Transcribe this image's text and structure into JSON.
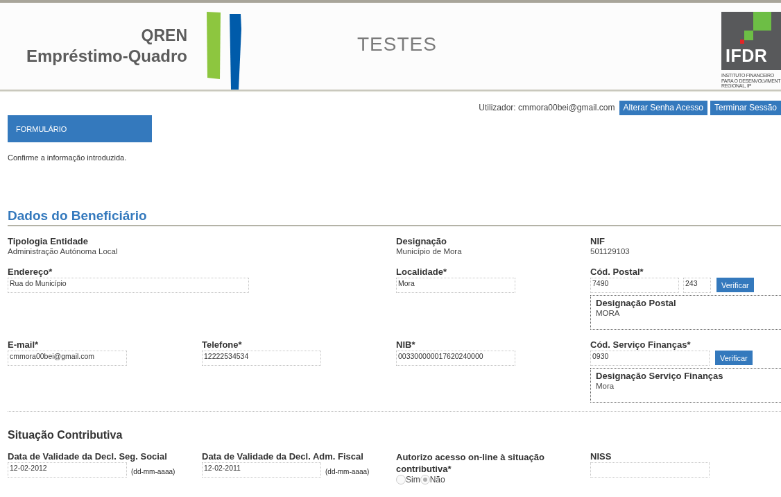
{
  "header": {
    "app_label": "QREN",
    "app_name": "Empréstimo-Quadro",
    "environment": "TESTES",
    "org_logo": {
      "acronym": "IFDR",
      "lines": [
        "INSTITUTO FINANCEIRO",
        "PARA O DESENVOLVIMENT",
        "REGIONAL, IP"
      ]
    }
  },
  "user_bar": {
    "user_label": "Utilizador: cmmora00bei@gmail.com",
    "buttons": [
      "Alterar Senha Acesso",
      "Terminar Sessão"
    ]
  },
  "tabs": [
    {
      "label": "FORMULÁRIO",
      "selected": true
    }
  ],
  "notice": "Confirme a informação introduzida.",
  "beneficiary": {
    "title": "Dados do Beneficiário",
    "rows": [
      [
        {
          "kind": "readonly",
          "label": "Tipologia Entidade",
          "value": "Administração Autónoma Local"
        },
        {
          "kind": "empty"
        },
        {
          "kind": "readonly",
          "label": "Designação",
          "value": "Município de Mora"
        },
        {
          "kind": "readonly",
          "label": "NIF",
          "value": "501129103"
        }
      ],
      [
        {
          "kind": "wide_input",
          "label": "Endereço*",
          "value": "Rua do Município"
        },
        {
          "kind": "empty"
        },
        {
          "kind": "input",
          "label": "Localidade*",
          "value": "Mora"
        },
        {
          "kind": "postal",
          "label": "Cód. Postal*",
          "values": [
            "7490",
            "243"
          ],
          "button": "Verificar",
          "lookup": {
            "label": "Designação Postal",
            "value": "MORA"
          }
        }
      ],
      [
        {
          "kind": "input",
          "label": "E-mail*",
          "value": "cmmora00bei@gmail.com"
        },
        {
          "kind": "input",
          "label": "Telefone*",
          "value": "12222534534"
        },
        {
          "kind": "input",
          "label": "NIB*",
          "value": "003300000017620240000"
        },
        {
          "kind": "code_lookup",
          "label": "Cód. Serviço Finanças*",
          "value": "0930",
          "button": "Verificar",
          "lookup": {
            "label": "Designação Serviço Finanças",
            "value": "Mora"
          }
        }
      ]
    ]
  },
  "contributive": {
    "title": "Situação Contributiva",
    "fields": [
      {
        "kind": "date",
        "label": "Data de Validade da Decl. Seg. Social",
        "value": "12-02-2012",
        "hint": "(dd-mm-aaaa)"
      },
      {
        "kind": "date",
        "label": "Data de Validade da Decl. Adm. Fiscal",
        "value": "12-02-2011",
        "hint": "(dd-mm-aaaa)"
      },
      {
        "kind": "radio",
        "label": "Autorizo acesso on-line à situação contributiva*",
        "options": [
          {
            "label": "Sim",
            "selected": false
          },
          {
            "label": "Não",
            "selected": true
          }
        ]
      },
      {
        "kind": "input",
        "label": "NISS"
      }
    ]
  }
}
